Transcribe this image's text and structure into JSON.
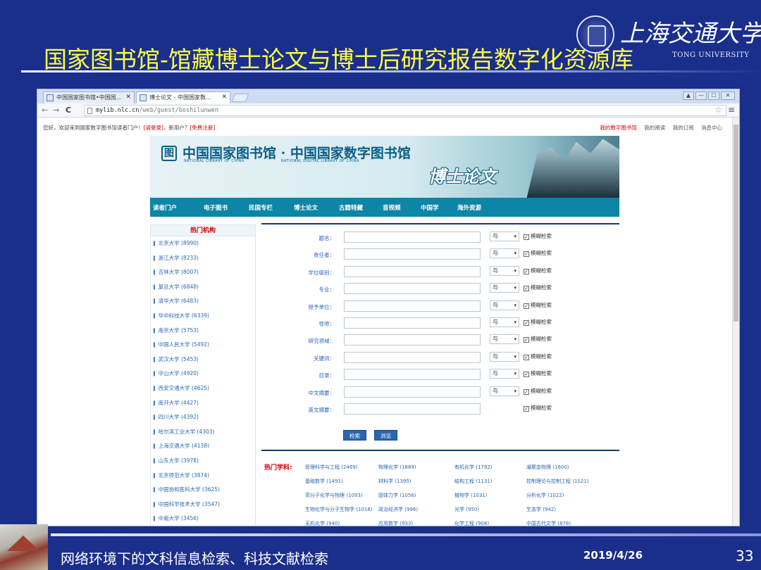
{
  "slide": {
    "title": "国家图书馆-馆藏博士论文与博士后研究报告数字化资源库",
    "logo_text": "上海交通大学",
    "logo_sub": "TONG UNIVERSITY",
    "footer_text": "网络环境下的文科信息检索、科技文献检索",
    "date": "2019/4/26",
    "page_number": "33"
  },
  "browser": {
    "tabs": [
      {
        "label": "中国国家图书馆•中国国..."
      },
      {
        "label": "博士论文 - 中国国家数..."
      }
    ],
    "url_host": "mylib.nlc.cn",
    "url_path": "/web/guest/boshilunwen",
    "window_buttons": [
      "▲",
      "—",
      "☐",
      "✕"
    ]
  },
  "page": {
    "welcome": "您好，欢迎来到国家数字图书馆读者门户！",
    "login": "[请登录]",
    "newuser": "，新用户？",
    "register": "[免费注册]",
    "top_links": [
      "我的数字图书馆",
      "我的阅读",
      "我的订阅",
      "消息中心"
    ],
    "banner_name": "中国国家图书馆 · 中国国家数字图书馆",
    "banner_en_1": "NATIONAL LIBRARY OF CHINA",
    "banner_en_2": "NATIONAL DIGITAL LIBRARY OF CHINA",
    "banner_calligraphy": "博士论文",
    "nav": [
      "读者门户",
      "电子图书",
      "民国专栏",
      "博士论文",
      "古籍特藏",
      "音视频",
      "中国学",
      "海外资源"
    ],
    "hot_institutions_title": "热门机构",
    "institutions": [
      "北京大学 (8990)",
      "浙江大学 (8233)",
      "吉林大学 (8007)",
      "复旦大学 (6848)",
      "清华大学 (6483)",
      "华中科技大学 (6339)",
      "南京大学 (5753)",
      "中国人民大学 (5492)",
      "武汉大学 (5453)",
      "中山大学 (4920)",
      "西安交通大学 (4625)",
      "南开大学 (4427)",
      "四川大学 (4392)",
      "哈尔滨工业大学 (4303)",
      "上海交通大学 (4138)",
      "山东大学 (3978)",
      "北京师范大学 (3874)",
      "中国协和医科大学 (3625)",
      "中国科学技术大学 (3547)",
      "中南大学 (3456)"
    ],
    "form_fields": [
      {
        "label": "题名：",
        "op": "与",
        "fuzzy": "模糊检索"
      },
      {
        "label": "责任者：",
        "op": "与",
        "fuzzy": "模糊检索"
      },
      {
        "label": "学位级别：",
        "op": "与",
        "fuzzy": "模糊检索"
      },
      {
        "label": "专业：",
        "op": "与",
        "fuzzy": "模糊检索"
      },
      {
        "label": "授予单位：",
        "op": "与",
        "fuzzy": "模糊检索"
      },
      {
        "label": "导师：",
        "op": "与",
        "fuzzy": "模糊检索"
      },
      {
        "label": "研究领域：",
        "op": "与",
        "fuzzy": "模糊检索"
      },
      {
        "label": "关键词：",
        "op": "与",
        "fuzzy": "模糊检索"
      },
      {
        "label": "目录：",
        "op": "与",
        "fuzzy": "模糊检索"
      },
      {
        "label": "中文摘要：",
        "op": "与",
        "fuzzy": "模糊检索"
      },
      {
        "label": "英文摘要：",
        "op": "",
        "fuzzy": "模糊检索"
      }
    ],
    "search_button": "检索",
    "browse_button": "浏览",
    "hot_subjects_title": "热门学科:",
    "hot_subjects": [
      "管理科学与工程 (2469)",
      "物理化学 (1889)",
      "有机化学 (1792)",
      "凝聚态物理 (1600)",
      "基础数学 (1491)",
      "材料学 (1395)",
      "结构工程 (1131)",
      "控制理论与控制工程 (1121)",
      "高分子化学与物理 (1093)",
      "固体力学 (1056)",
      "植物学 (1031)",
      "分析化学 (1022)",
      "生物化学与分子生物学 (1018)",
      "政治经济学 (996)",
      "光学 (950)",
      "生态学 (942)",
      "无机化学 (940)",
      "应用数学 (933)",
      "化学工程 (908)",
      "中国古代文学 (878)"
    ]
  }
}
